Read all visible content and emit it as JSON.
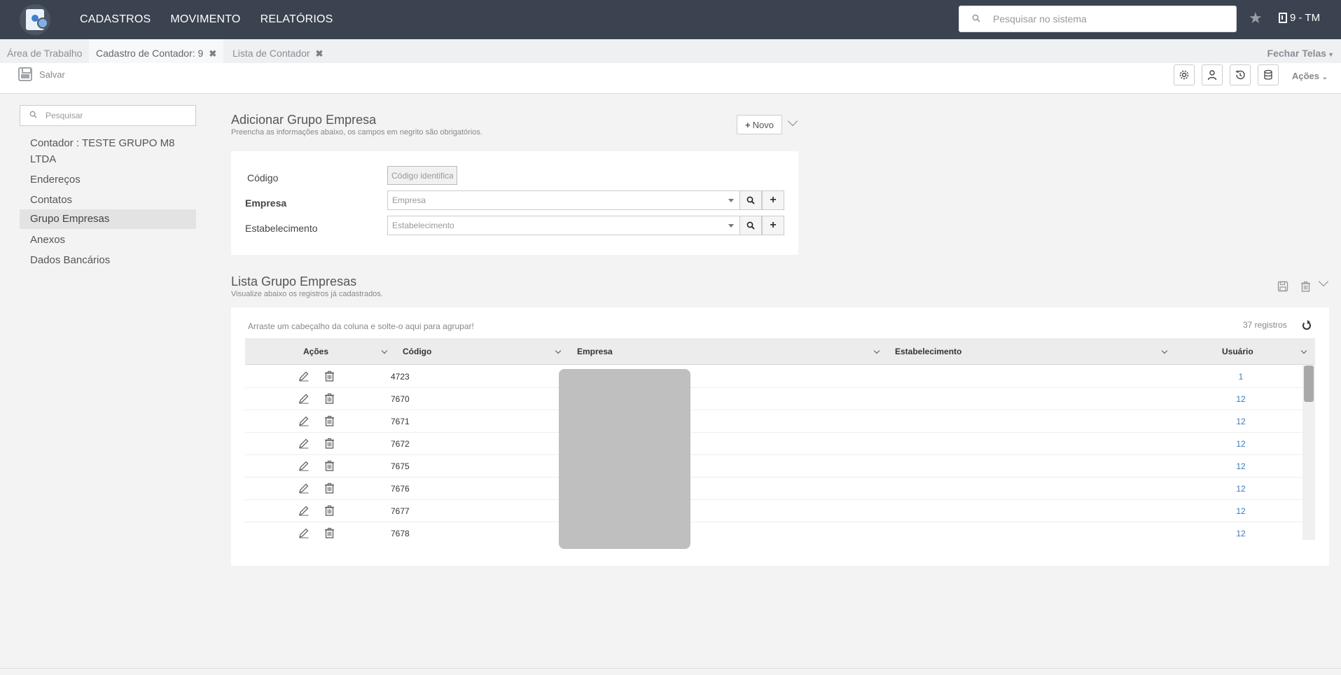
{
  "nav": {
    "items": [
      "CADASTROS",
      "MOVIMENTO",
      "RELATÓRIOS"
    ],
    "search_placeholder": "Pesquisar no sistema",
    "company": "9 - TM"
  },
  "tabs": {
    "items": [
      {
        "label": "Área de Trabalho"
      },
      {
        "label": "Cadastro de Contador: 9"
      },
      {
        "label": "Lista de Contador"
      }
    ],
    "close_all": "Fechar Telas"
  },
  "toolbar": {
    "save_label": "Salvar",
    "actions_label": "Ações"
  },
  "sidebar": {
    "search_placeholder": "Pesquisar",
    "items": [
      {
        "label": "Contador : TESTE GRUPO M8 LTDA"
      },
      {
        "label": "Endereços"
      },
      {
        "label": "Contatos"
      },
      {
        "label": "Grupo Empresas"
      },
      {
        "label": "Anexos"
      },
      {
        "label": "Dados Bancários"
      }
    ]
  },
  "add_section": {
    "title": "Adicionar Grupo Empresa",
    "subtitle": "Preencha as informações abaixo, os campos em negrito são obrigatórios.",
    "new_button": "Novo",
    "fields": {
      "code_label": "Código",
      "code_placeholder": "Código identificador",
      "company_label": "Empresa",
      "company_placeholder": "Empresa",
      "establishment_label": "Estabelecimento",
      "establishment_placeholder": "Estabelecimento"
    }
  },
  "list_section": {
    "title": "Lista Grupo Empresas",
    "subtitle": "Visualize abaixo os registros já cadastrados.",
    "group_hint": "Arraste um cabeçalho da coluna e solte-o aqui para agrupar!",
    "record_count": "37 registros",
    "columns": [
      "Ações",
      "Código",
      "Empresa",
      "Estabelecimento",
      "Usuário"
    ],
    "rows": [
      {
        "code": "4723",
        "user": "1"
      },
      {
        "code": "7670",
        "user": "12"
      },
      {
        "code": "7671",
        "user": "12"
      },
      {
        "code": "7672",
        "user": "12"
      },
      {
        "code": "7675",
        "user": "12"
      },
      {
        "code": "7676",
        "user": "12"
      },
      {
        "code": "7677",
        "user": "12"
      },
      {
        "code": "7678",
        "user": "12"
      }
    ]
  }
}
